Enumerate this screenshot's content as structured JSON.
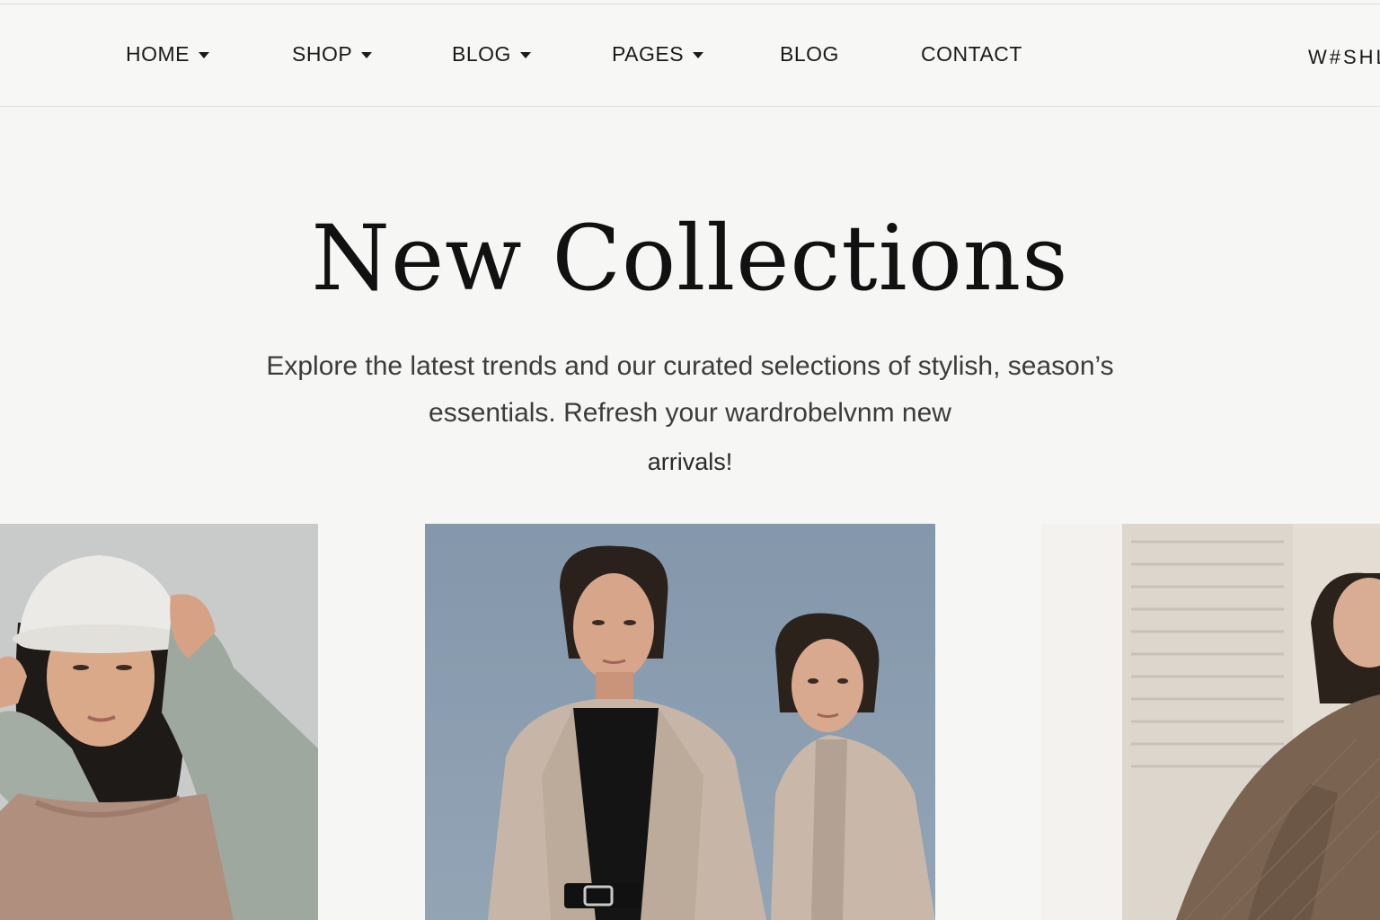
{
  "nav": {
    "items": [
      {
        "label": "HOME",
        "dropdown": true
      },
      {
        "label": "SHOP",
        "dropdown": true
      },
      {
        "label": "BLOG",
        "dropdown": true
      },
      {
        "label": "PAGES",
        "dropdown": true
      },
      {
        "label": "BLOG",
        "dropdown": false
      },
      {
        "label": "CONTACT",
        "dropdown": false
      }
    ],
    "wishlist_label": "W#SHL"
  },
  "hero": {
    "title": "New Collections",
    "subtitle_line1": "Explore the latest trends and our curated selections of stylish, season’s",
    "subtitle_line2": "essentials. Refresh your wardrobelvnm new",
    "subtitle_line3": "arrivals!"
  },
  "colors": {
    "background": "#f6f6f5",
    "text": "#1b1b1b",
    "photo_left_bg": "#c9cccb",
    "photo_mid_sky": "#8a9cae",
    "photo_right_bg": "#e9e5df"
  }
}
